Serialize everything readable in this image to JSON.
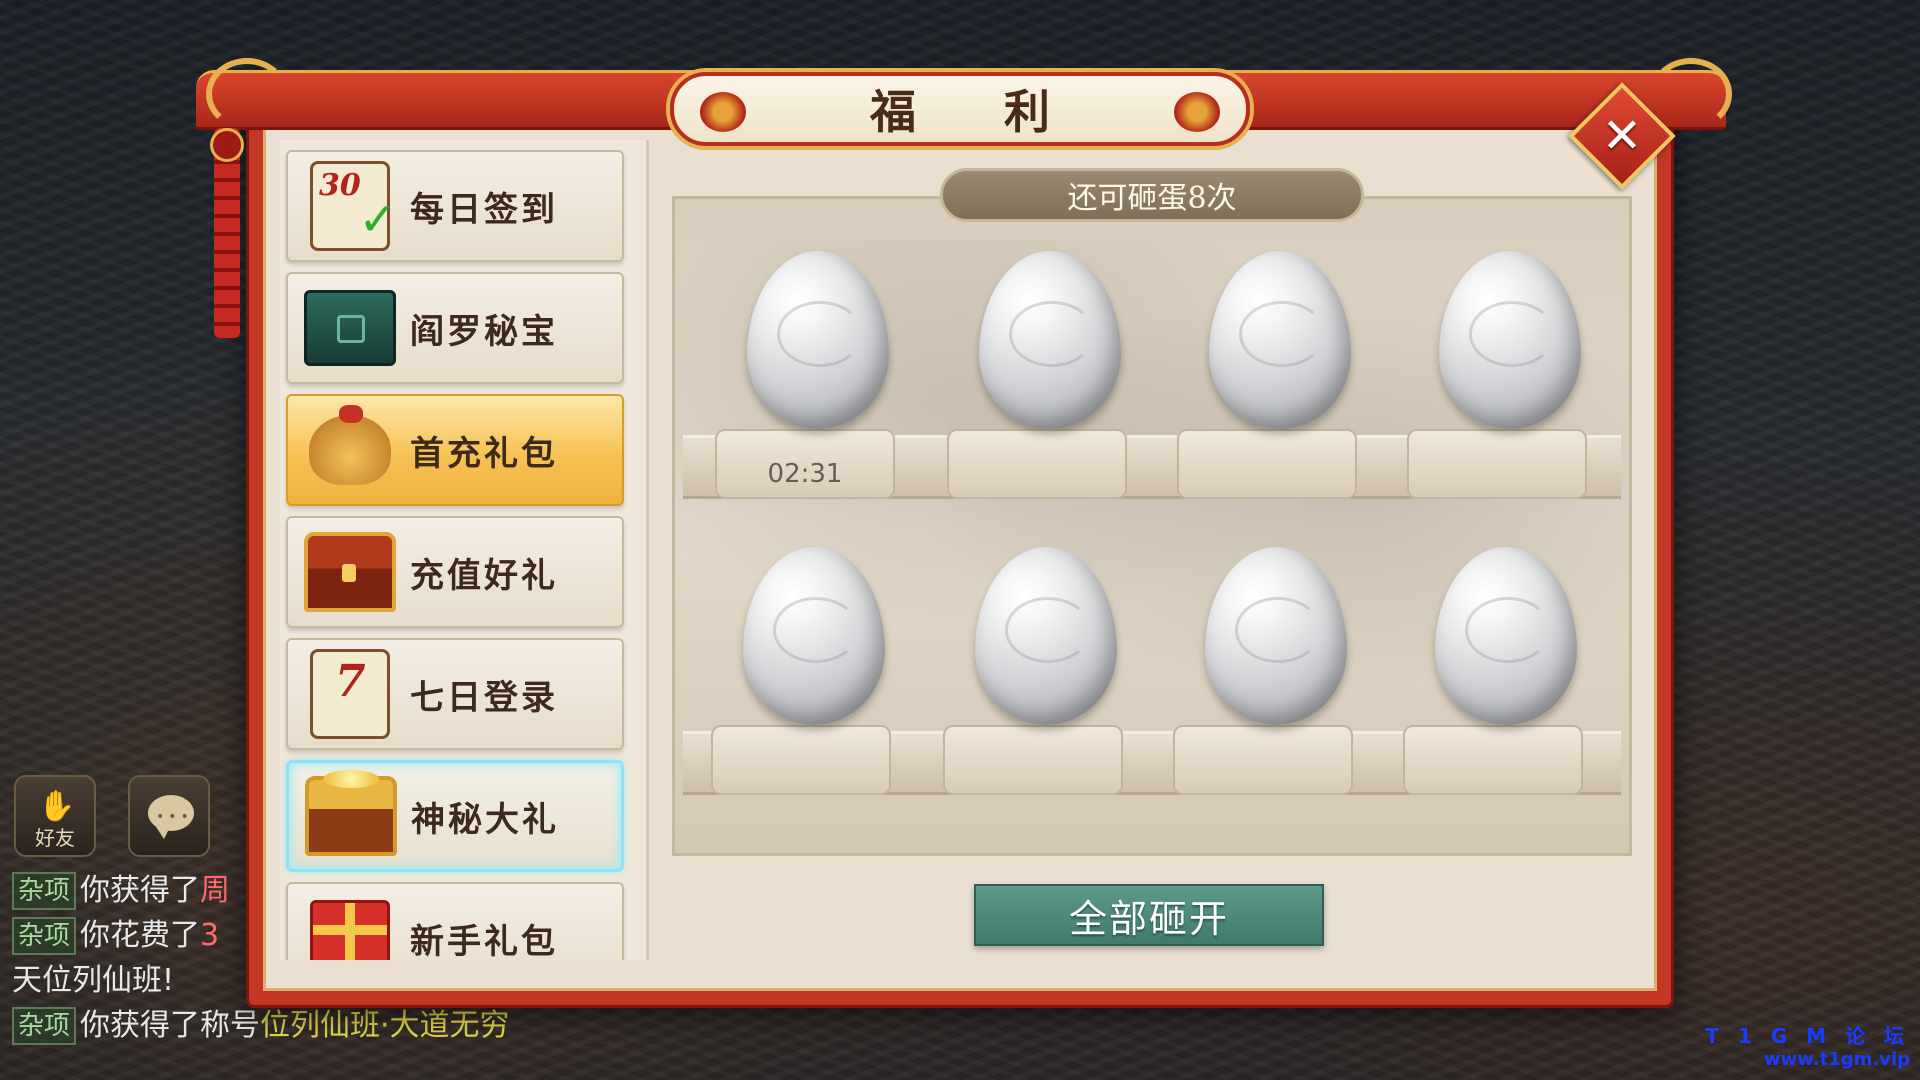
{
  "dialog": {
    "title": "福 利",
    "close_icon": "close-icon"
  },
  "sidebar": {
    "items": [
      {
        "label": "每日签到",
        "icon": "calendar-check-icon",
        "icon_text": "30",
        "state": "normal"
      },
      {
        "label": "阎罗秘宝",
        "icon": "green-chest-icon",
        "state": "normal"
      },
      {
        "label": "首充礼包",
        "icon": "money-bag-icon",
        "state": "active"
      },
      {
        "label": "充值好礼",
        "icon": "red-chest-icon",
        "state": "normal"
      },
      {
        "label": "七日登录",
        "icon": "calendar-7-icon",
        "icon_text": "7",
        "state": "normal"
      },
      {
        "label": "神秘大礼",
        "icon": "gold-chest-icon",
        "state": "highlighted"
      },
      {
        "label": "新手礼包",
        "icon": "gift-box-icon",
        "state": "normal"
      }
    ]
  },
  "eggs": {
    "counter_text": "还可砸蛋8次",
    "slots": [
      {
        "timer": "02:31"
      },
      {
        "timer": ""
      },
      {
        "timer": ""
      },
      {
        "timer": ""
      },
      {
        "timer": ""
      },
      {
        "timer": ""
      },
      {
        "timer": ""
      },
      {
        "timer": ""
      }
    ],
    "smash_all_label": "全部砸开"
  },
  "hud": {
    "friend_label": "好友",
    "chat_icon": "chat-bubble-icon"
  },
  "chat": {
    "tag": "杂项",
    "lines": [
      {
        "tag": "杂项",
        "text": "你获得了",
        "highlight": "周"
      },
      {
        "tag": "杂项",
        "text": "你花费了",
        "highlight": "3"
      },
      {
        "tag": "",
        "text": "天位列仙班!",
        "highlight": ""
      },
      {
        "tag": "杂项",
        "text": "你获得了称号",
        "highlight": "位列仙班·大道无穷"
      }
    ]
  },
  "watermark": {
    "line1": "T 1 G M 论 坛",
    "line2": "www.t1gm.vip"
  },
  "colors": {
    "frame_red": "#c33626",
    "gold": "#e6b04f",
    "active_tab": "#f6c254",
    "highlight_tab": "#9feaf6",
    "smash_button": "#4f8a7c"
  }
}
